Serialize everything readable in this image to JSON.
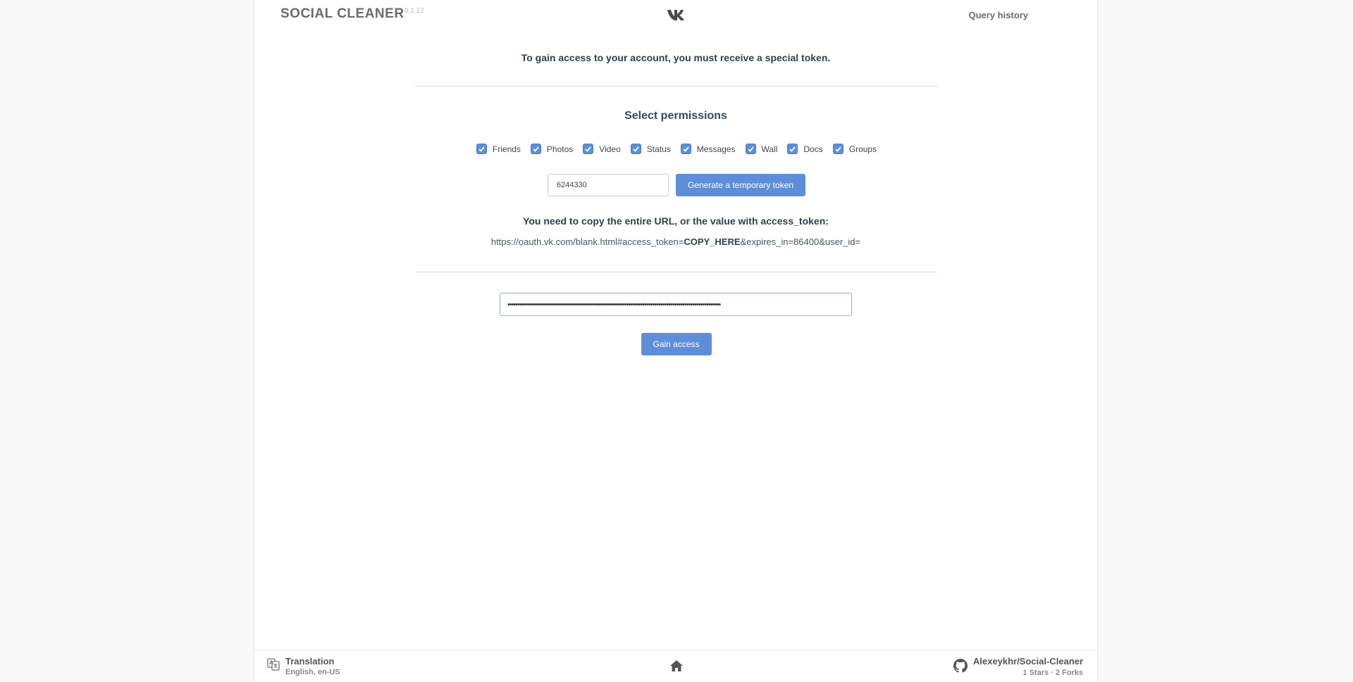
{
  "header": {
    "logo": "SOCIAL CLEANER",
    "version": "0.1.12",
    "query_history": "Query history"
  },
  "intro": "To gain access to your account, you must receive a special token.",
  "permissions": {
    "title": "Select permissions",
    "items": [
      {
        "label": "Friends",
        "checked": true
      },
      {
        "label": "Photos",
        "checked": true
      },
      {
        "label": "Video",
        "checked": true
      },
      {
        "label": "Status",
        "checked": true
      },
      {
        "label": "Messages",
        "checked": true
      },
      {
        "label": "Wall",
        "checked": true
      },
      {
        "label": "Docs",
        "checked": true
      },
      {
        "label": "Groups",
        "checked": true
      }
    ]
  },
  "token": {
    "app_id": "6244330",
    "generate_label": "Generate a temporary token",
    "copy_hint": "You need to copy the entire URL, or the value with access_token:",
    "url_prefix": "https://oauth.vk.com/blank.html#access_token=",
    "url_highlight": "COPY_HERE",
    "url_suffix": "&expires_in=86400&user_id=",
    "token_value": "••••••••••••••••••••••••••••••••••••••••••••••••••••••••••••••••••••••••••••••••••••••••••••••••••••••••••",
    "gain_access_label": "Gain access"
  },
  "footer": {
    "translation_title": "Translation",
    "translation_sub": "English, en-US",
    "github_repo": "Alexeykhr/Social-Cleaner",
    "github_stats": "1 Stars  ·  2 Forks"
  },
  "colors": {
    "accent": "#5e8ed9",
    "text": "#35495e"
  }
}
